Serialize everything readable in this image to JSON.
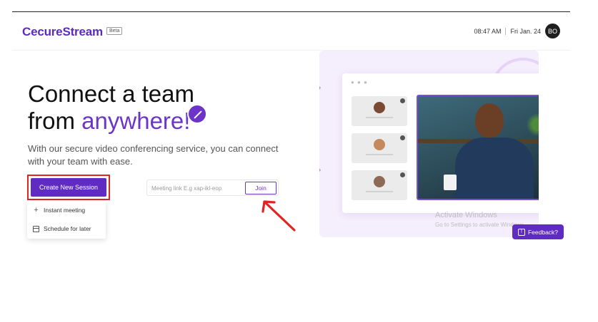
{
  "header": {
    "logo": "CecureStream",
    "badge": "Beta",
    "time": "08:47 AM",
    "date": "Fri Jan. 24",
    "avatar_initials": "BO"
  },
  "hero": {
    "line1": "Connect a team",
    "line2_plain": "from ",
    "line2_accent": "anywhere!",
    "subtitle": "With our secure video conferencing service, you can connect with your team with ease."
  },
  "actions": {
    "create_label": "Create New Session",
    "menu_items": [
      {
        "icon": "plus-icon",
        "label": "Instant meeting"
      },
      {
        "icon": "calendar-icon",
        "label": "Schedule for later"
      }
    ],
    "meeting_input_placeholder": "Meeting link E.g xap-ikl-eop",
    "meeting_input_value": "",
    "join_label": "Join"
  },
  "watermark": {
    "line1": "Activate Windows",
    "line2": "Go to Settings to activate Windows."
  },
  "feedback": {
    "label": "Feedback?",
    "icon": "feedback-icon"
  },
  "colors": {
    "brand": "#5f2bc2",
    "accent": "#6c34c9",
    "highlight": "#e02424"
  }
}
